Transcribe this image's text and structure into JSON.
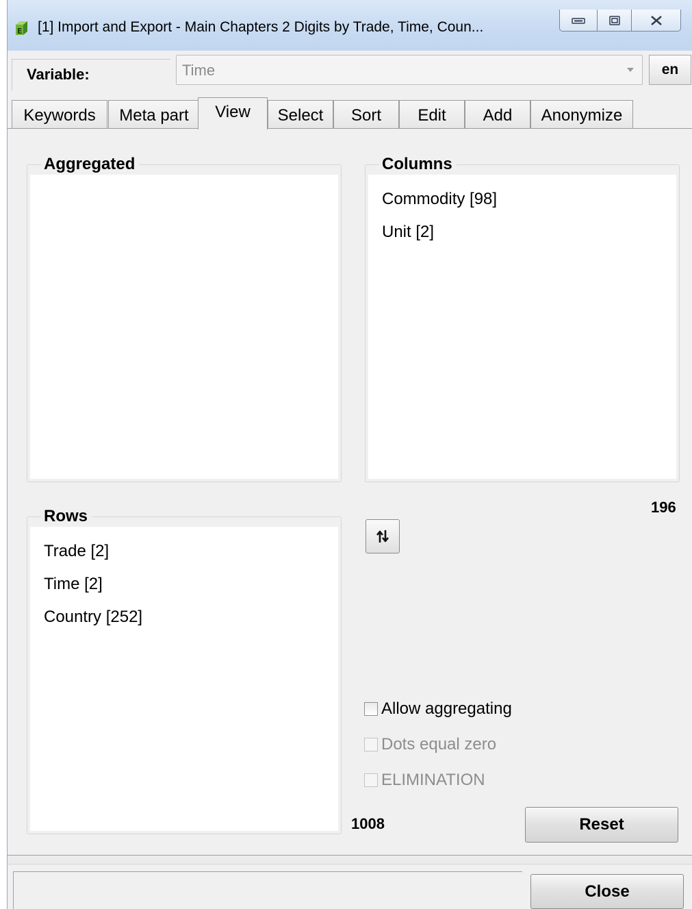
{
  "window": {
    "title": "[1]  Import and Export - Main Chapters 2 Digits by Trade, Time, Coun...",
    "icon_letter": "E",
    "controls": [
      "minimize-icon",
      "maximize-icon",
      "close-icon"
    ]
  },
  "variable": {
    "label": "Variable:",
    "selected": "Time",
    "language_button": "en"
  },
  "tabs": [
    {
      "label": "Keywords",
      "active": false
    },
    {
      "label": "Meta part",
      "active": false
    },
    {
      "label": "View",
      "active": true
    },
    {
      "label": "Select",
      "active": false
    },
    {
      "label": "Sort",
      "active": false
    },
    {
      "label": "Edit",
      "active": false
    },
    {
      "label": "Add",
      "active": false
    },
    {
      "label": "Anonymize",
      "active": false
    }
  ],
  "view": {
    "aggregated": {
      "title": "Aggregated",
      "items": []
    },
    "columns": {
      "title": "Columns",
      "items": [
        "Commodity   [98]",
        "Unit   [2]"
      ],
      "count": "196"
    },
    "rows": {
      "title": "Rows",
      "items": [
        "Trade   [2]",
        "Time   [2]",
        "Country   [252]"
      ],
      "count": "1008"
    },
    "swap_icon": "swap-arrows-icon",
    "options": [
      {
        "label": "Allow aggregating",
        "checked": false,
        "enabled": true
      },
      {
        "label": "Dots equal zero",
        "checked": false,
        "enabled": false
      },
      {
        "label": "ELIMINATION",
        "checked": false,
        "enabled": false
      }
    ],
    "reset_label": "Reset"
  },
  "footer": {
    "close_label": "Close"
  }
}
